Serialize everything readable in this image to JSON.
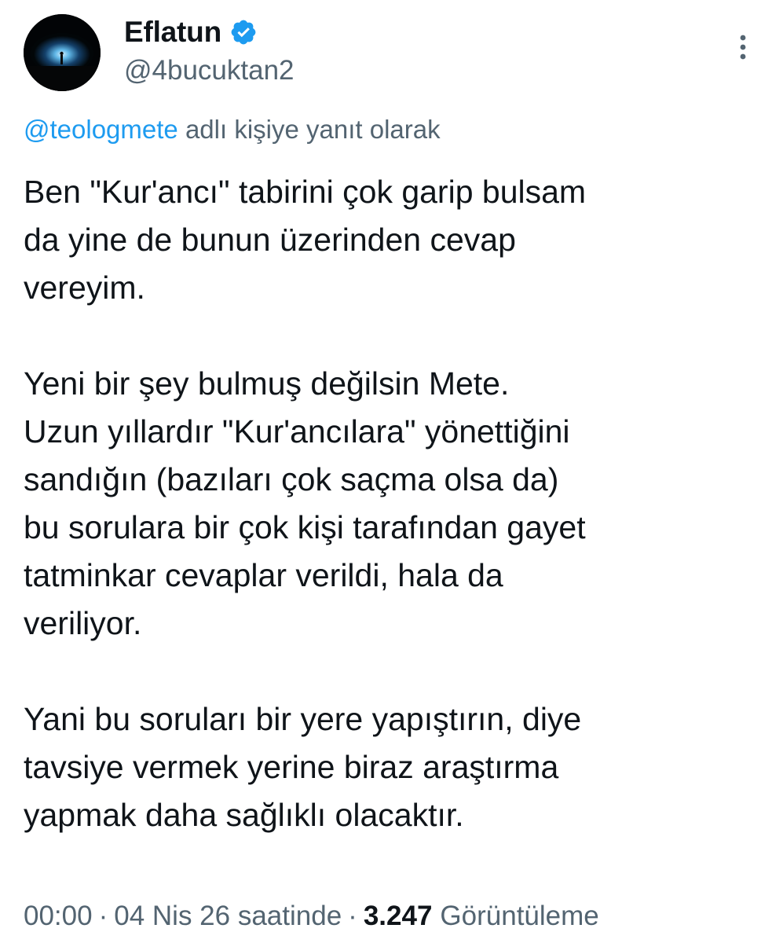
{
  "author": {
    "display_name": "Eflatun",
    "handle": "@4bucuktan2",
    "verified_badge_icon": "verified-badge-icon",
    "avatar_icon": "avatar-night-sky-icon"
  },
  "header": {
    "more_icon": "more-vertical-icon"
  },
  "reply": {
    "mention": "@teologmete",
    "suffix": " adlı kişiye yanıt olarak"
  },
  "tweet": {
    "text": "Ben \"Kur'ancı\" tabirini çok garip bulsam\nda yine de bunun üzerinden cevap\nvereyim.\n\nYeni bir şey bulmuş değilsin Mete.\nUzun yıllardır \"Kur'ancılara\" yönettiğini\nsandığın (bazıları çok saçma olsa da)\nbu sorulara bir çok kişi tarafından gayet\ntatminkar cevaplar verildi, hala da\nveriliyor.\n\nYani bu soruları bir yere yapıştırın, diye\ntavsiye vermek yerine biraz araştırma\nyapmak daha sağlıklı olacaktır."
  },
  "meta": {
    "time": "00:00",
    "separator": "·",
    "date": "04 Nis 26 saatinde",
    "views_count": "3.247",
    "views_label": "Görüntüleme"
  },
  "colors": {
    "text_primary": "#0f1419",
    "text_secondary": "#536471",
    "accent": "#1d9bf0"
  }
}
